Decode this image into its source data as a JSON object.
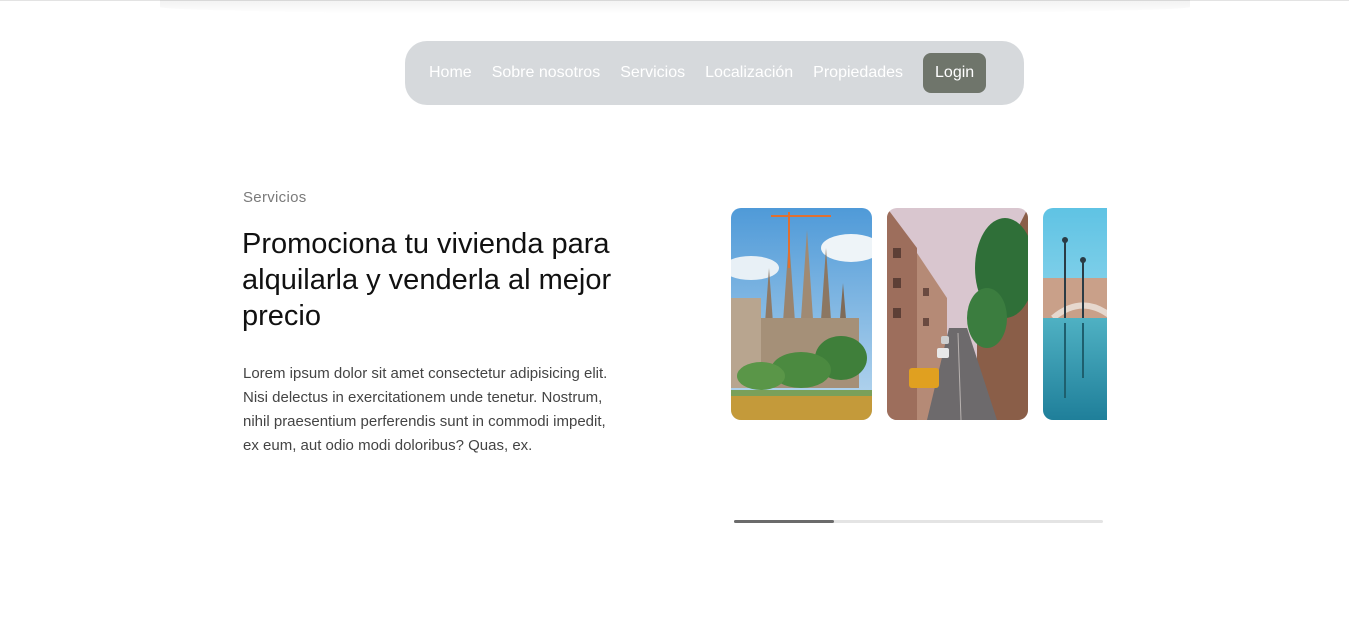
{
  "nav": {
    "items": [
      {
        "label": "Home"
      },
      {
        "label": "Sobre nosotros"
      },
      {
        "label": "Servicios"
      },
      {
        "label": "Localización"
      },
      {
        "label": "Propiedades"
      }
    ],
    "login_label": "Login"
  },
  "section": {
    "eyebrow": "Servicios",
    "title": "Promociona tu vivienda para alquilarla y venderla al mejor precio",
    "body": "Lorem ipsum dolor sit amet consectetur adipisicing elit. Nisi delectus in exercitationem unde tenetur. Nostrum, nihil praesentium perferendis sunt in commodi impedit, ex eum, aut odio modi doloribus? Quas, ex."
  },
  "carousel": {
    "progress": 0.27
  },
  "colors": {
    "nav_bg": "#d6d9dc",
    "login_bg": "#6f756b",
    "progress_fill": "#6b6b6b",
    "progress_track": "#e4e4e4"
  }
}
